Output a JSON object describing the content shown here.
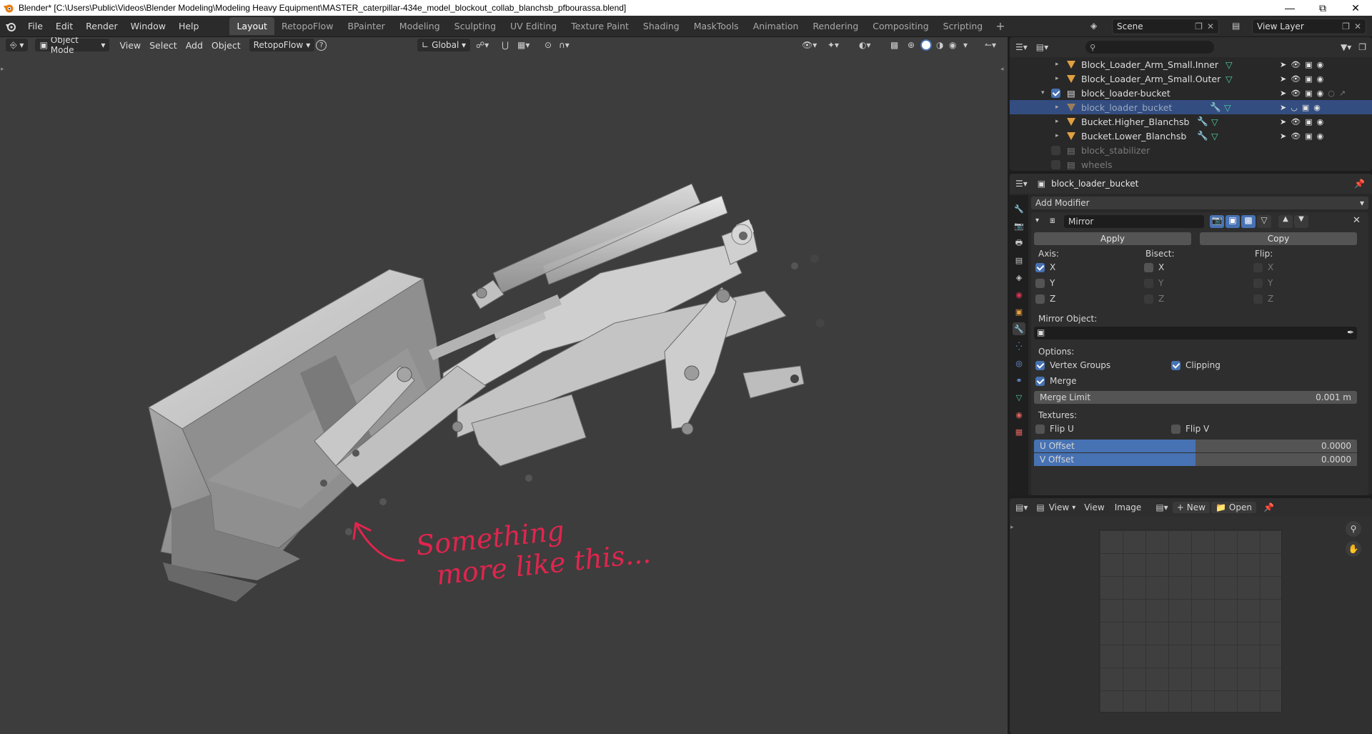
{
  "window": {
    "title": "Blender* [C:\\Users\\Public\\Videos\\Blender Modeling\\Modeling Heavy Equipment\\MASTER_caterpillar-434e_model_blockout_collab_blanchsb_pfbourassa.blend]"
  },
  "menu": [
    "File",
    "Edit",
    "Render",
    "Window",
    "Help"
  ],
  "workspaces": [
    "Layout",
    "RetopoFlow",
    "BPainter",
    "Modeling",
    "Sculpting",
    "UV Editing",
    "Texture Paint",
    "Shading",
    "MaskTools",
    "Animation",
    "Rendering",
    "Compositing",
    "Scripting"
  ],
  "scene": {
    "name": "Scene",
    "view_layer": "View Layer"
  },
  "viewport": {
    "mode": "Object Mode",
    "menus": [
      "View",
      "Select",
      "Add",
      "Object"
    ],
    "addon_menu": "RetopoFlow",
    "transform_orientation": "Global",
    "annotation_line1": "Something",
    "annotation_line2": "more like this..."
  },
  "outliner": {
    "rows": [
      {
        "name": "Block_Loader_Arm_Small.Inner"
      },
      {
        "name": "Block_Loader_Arm_Small.Outer"
      },
      {
        "name": "block_loader-bucket"
      },
      {
        "name": "block_loader_bucket"
      },
      {
        "name": "Bucket.Higher_Blanchsb"
      },
      {
        "name": "Bucket.Lower_Blanchsb"
      },
      {
        "name": "block_stabilizer"
      },
      {
        "name": "wheels"
      }
    ]
  },
  "properties": {
    "object_name": "block_loader_bucket",
    "add_modifier": "Add Modifier",
    "modifier": {
      "name": "Mirror",
      "apply": "Apply",
      "copy": "Copy",
      "axis_label": "Axis:",
      "bisect_label": "Bisect:",
      "flip_label": "Flip:",
      "axes": [
        "X",
        "Y",
        "Z"
      ],
      "mirror_object_label": "Mirror Object:",
      "options_label": "Options:",
      "vertex_groups": "Vertex Groups",
      "clipping": "Clipping",
      "merge": "Merge",
      "merge_limit_label": "Merge Limit",
      "merge_limit_value": "0.001 m",
      "textures_label": "Textures:",
      "flip_u": "Flip U",
      "flip_v": "Flip V",
      "u_offset_label": "U Offset",
      "u_offset_value": "0.0000",
      "v_offset_label": "V Offset",
      "v_offset_value": "0.0000"
    }
  },
  "image_editor": {
    "view": "View",
    "menus": [
      "View",
      "Image"
    ],
    "new": "New",
    "open": "Open"
  }
}
